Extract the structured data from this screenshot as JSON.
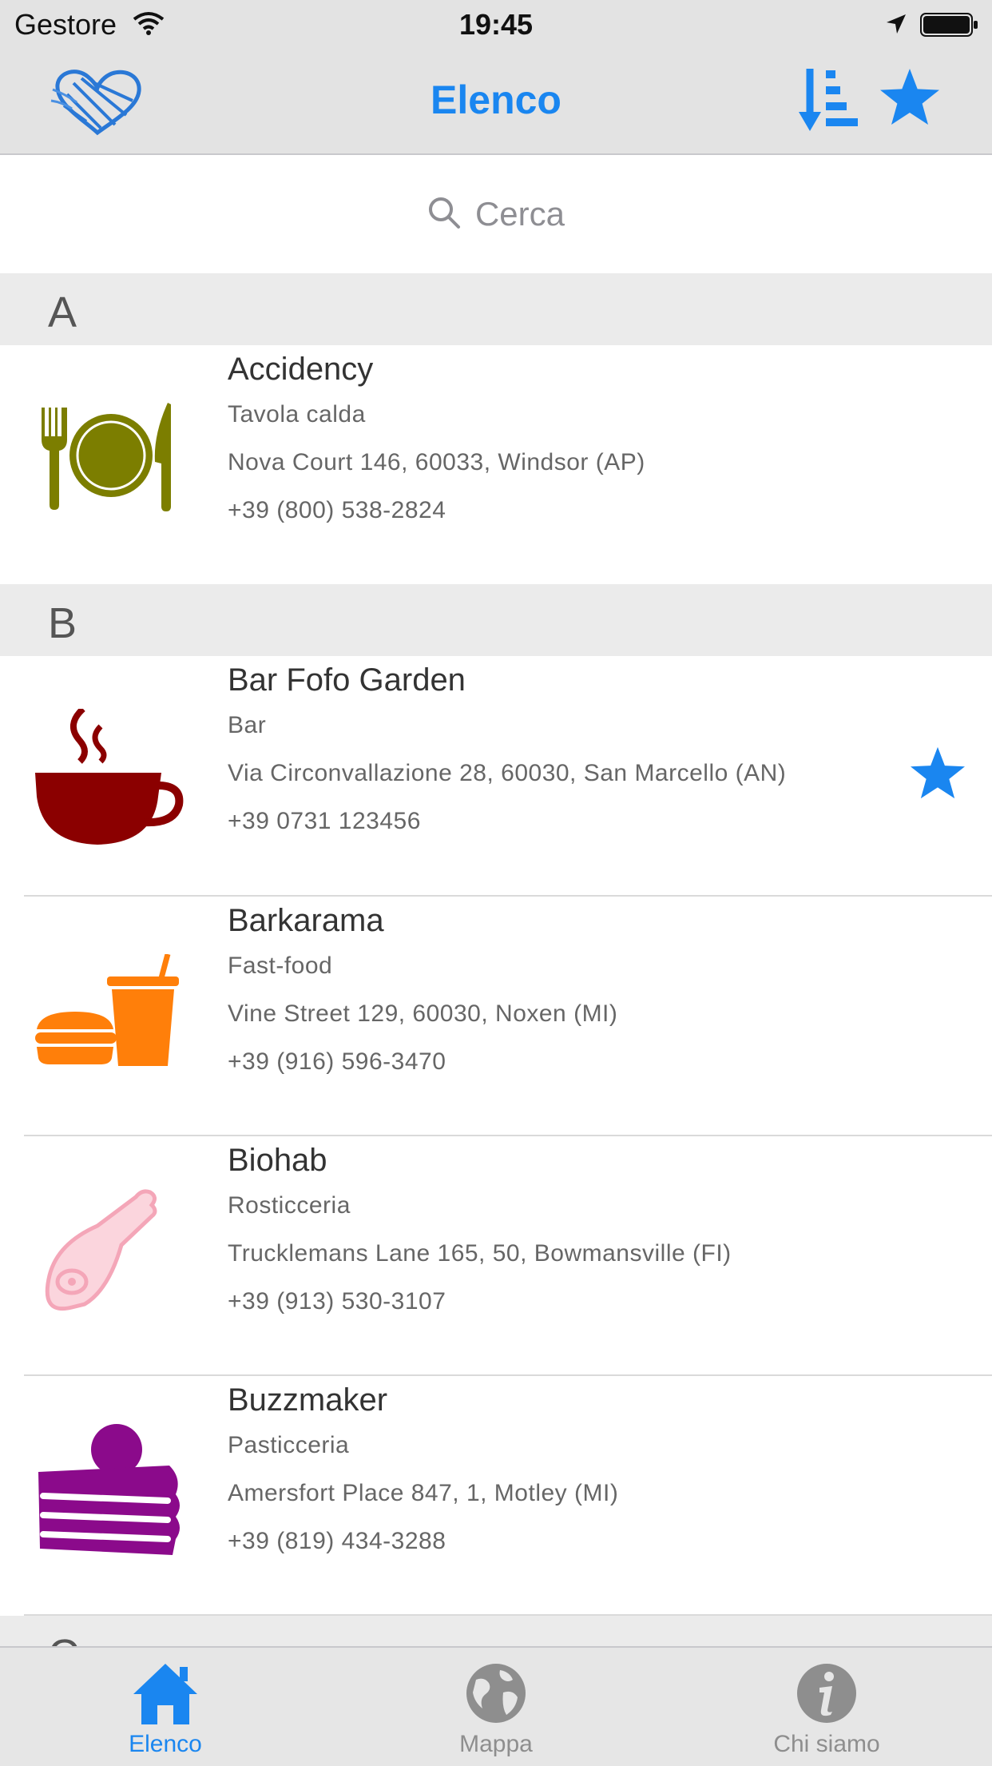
{
  "status_bar": {
    "carrier": "Gestore",
    "time": "19:45"
  },
  "nav_bar": {
    "title": "Elenco"
  },
  "search": {
    "placeholder": "Cerca"
  },
  "sections": [
    {
      "letter": "A",
      "items": [
        {
          "name": "Accidency",
          "category": "Tavola calda",
          "address": "Nova Court 146, 60033, Windsor (AP)",
          "phone": "+39 (800) 538-2824",
          "favorite": false,
          "icon": "plate-cutlery-icon"
        }
      ]
    },
    {
      "letter": "B",
      "items": [
        {
          "name": "Bar Fofo Garden",
          "category": "Bar",
          "address": "Via Circonvallazione 28, 60030, San Marcello (AN)",
          "phone": "+39 0731 123456",
          "favorite": true,
          "icon": "coffee-cup-icon"
        },
        {
          "name": "Barkarama",
          "category": "Fast-food",
          "address": "Vine Street 129, 60030, Noxen (MI)",
          "phone": "+39 (916) 596-3470",
          "favorite": false,
          "icon": "burger-drink-icon"
        },
        {
          "name": "Biohab",
          "category": "Rosticceria",
          "address": "Trucklemans Lane 165, 50, Bowmansville (FI)",
          "phone": "+39 (913) 530-3107",
          "favorite": false,
          "icon": "ham-leg-icon"
        },
        {
          "name": "Buzzmaker",
          "category": "Pasticceria",
          "address": "Amersfort Place 847, 1, Motley (MI)",
          "phone": "+39 (819) 434-3288",
          "favorite": false,
          "icon": "cake-slice-icon"
        }
      ]
    },
    {
      "letter": "C",
      "items": []
    }
  ],
  "tab_bar": {
    "tabs": [
      {
        "label": "Elenco",
        "icon": "home-icon",
        "active": true
      },
      {
        "label": "Mappa",
        "icon": "globe-icon",
        "active": false
      },
      {
        "label": "Chi siamo",
        "icon": "info-icon",
        "active": false
      }
    ]
  },
  "colors": {
    "accent": "#1a86f0",
    "plate": "#7c7e00",
    "coffee": "#8b0000",
    "fastfood": "#ff7f0a",
    "ham": "#f7b6c4",
    "cake": "#8b0a8b",
    "inactive": "#8e8e8e"
  }
}
